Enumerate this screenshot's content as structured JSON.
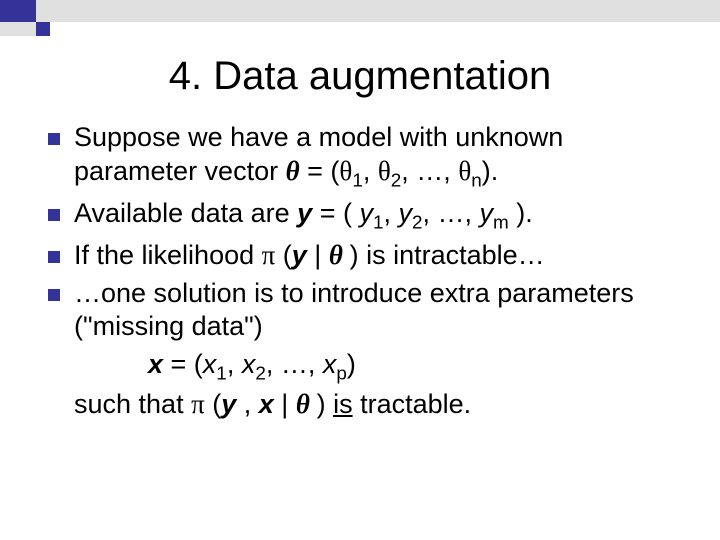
{
  "title": "4. Data augmentation",
  "bullets": {
    "b1_a": "Suppose we have a model with unknown parameter vector ",
    "b1_theta": "θ",
    "b1_b": " = (",
    "b1_t1": "θ",
    "b1_s1": "1",
    "b1_c": ", ",
    "b1_t2": "θ",
    "b1_s2": "2",
    "b1_d": ", …, ",
    "b1_tn": "θ",
    "b1_sn": "n",
    "b1_e": ").",
    "b2_a": "Available data are ",
    "b2_y": "y",
    "b2_b": " = ( ",
    "b2_y1": "y",
    "b2_s1": "1",
    "b2_c": ", ",
    "b2_y2": "y",
    "b2_s2": "2",
    "b2_d": ", …, ",
    "b2_ym": "y",
    "b2_sm": "m",
    "b2_e": " ).",
    "b3_a": "If the likelihood ",
    "b3_pi": "π",
    "b3_b": " (",
    "b3_y": "y",
    "b3_c": " | ",
    "b3_th": "θ ",
    "b3_d": ") is intractable…",
    "b4_a": "…one solution is to introduce extra parameters (\"missing data\")",
    "b4_indent_x": "x",
    "b4_indent_a": " = (",
    "b4_x1": "x",
    "b4_s1": "1",
    "b4_b": ", ",
    "b4_x2": "x",
    "b4_s2": "2",
    "b4_c": ", …, ",
    "b4_xp": "x",
    "b4_sp": "p",
    "b4_d": ")",
    "b4_cont_a": "such that ",
    "b4_cont_pi": "π",
    "b4_cont_b": " (",
    "b4_cont_y": "y ",
    "b4_cont_c": ", ",
    "b4_cont_x": "x",
    "b4_cont_d": " | ",
    "b4_cont_th": "θ ",
    "b4_cont_e": ") ",
    "b4_cont_is": "is",
    "b4_cont_f": " tractable."
  }
}
